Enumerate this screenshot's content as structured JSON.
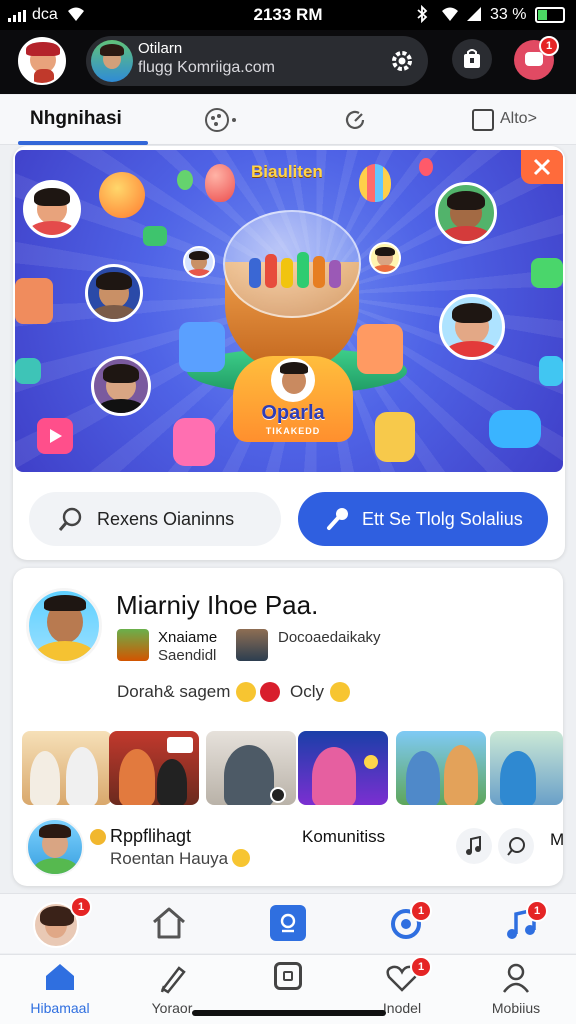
{
  "status": {
    "carrier": "dca",
    "time": "2133 RM",
    "battery": "33 %"
  },
  "account": {
    "name": "Otilarn",
    "email": "flugg Komriiga.com",
    "notifications": "1"
  },
  "tabs": [
    {
      "label": "Nhgnihasi"
    },
    {
      "label": "Alto>"
    }
  ],
  "banner": {
    "heading": "Biauliten",
    "badge_text": "Oparla",
    "badge_sub": "TIKAKEDD"
  },
  "actions": {
    "left_label": "Rexens Oianinns",
    "right_label": "Ett Se Tlolg Solalius"
  },
  "profile": {
    "title": "Miarniy Ihoe Paa.",
    "line1": "Xnaiame",
    "line2": "Saendidl",
    "line3": "Docoaedaikaky",
    "status_text": "Dorah& sagem",
    "status_text2": "Ocly"
  },
  "footer_row": {
    "line1": "Rppflihagt",
    "line2": "Roentan Hauya",
    "community": "Komunitiss",
    "trailing": "M"
  },
  "bottom_top_badges": [
    "1",
    "1",
    "1"
  ],
  "bottom_nav": [
    {
      "label": "Hibamaal"
    },
    {
      "label": "Yoraor"
    },
    {
      "label": ""
    },
    {
      "label": "Inodel",
      "badge": "1"
    },
    {
      "label": "Mobiius"
    }
  ],
  "colors": {
    "accent": "#2f5fe0",
    "banner": "#4f63e6",
    "badge": "#e52525"
  }
}
